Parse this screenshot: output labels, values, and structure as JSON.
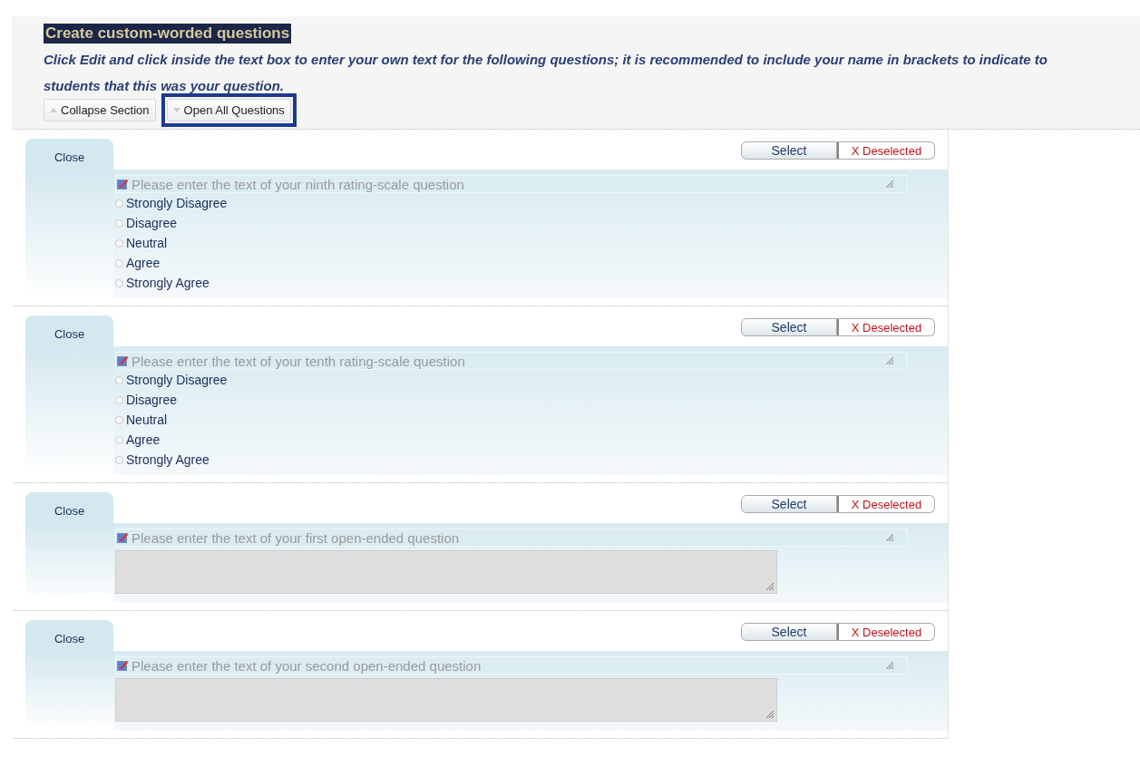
{
  "header": {
    "title": "Create custom-worded questions",
    "instructions": "Click Edit and click inside the text box to enter your own text for the following questions; it is recommended to include your name in brackets to indicate to students that this was your question.",
    "buttons": [
      {
        "label": "Collapse Section",
        "kind": "collapse",
        "highlighted": false
      },
      {
        "label": "Open All Questions",
        "kind": "expand",
        "highlighted": true
      }
    ]
  },
  "questions": [
    {
      "close_label": "Close",
      "select_label": "Select",
      "deselect_label": "X Deselected",
      "selected": false,
      "kind": "rating",
      "prompt": "Please enter the text of your ninth rating-scale question",
      "options": [
        {
          "label": "Strongly Disagree",
          "selected": false
        },
        {
          "label": "Disagree",
          "selected": false
        },
        {
          "label": "Neutral",
          "selected": false
        },
        {
          "label": "Agree",
          "selected": false
        },
        {
          "label": "Strongly Agree",
          "selected": false
        }
      ]
    },
    {
      "close_label": "Close",
      "select_label": "Select",
      "deselect_label": "X Deselected",
      "selected": false,
      "kind": "rating",
      "prompt": "Please enter the text of your tenth rating-scale question",
      "options": [
        {
          "label": "Strongly Disagree",
          "selected": false
        },
        {
          "label": "Disagree",
          "selected": false
        },
        {
          "label": "Neutral",
          "selected": false
        },
        {
          "label": "Agree",
          "selected": false
        },
        {
          "label": "Strongly Agree",
          "selected": false
        }
      ]
    },
    {
      "close_label": "Close",
      "select_label": "Select",
      "deselect_label": "X Deselected",
      "selected": false,
      "kind": "open",
      "prompt": "Please enter the text of your first open-ended question"
    },
    {
      "close_label": "Close",
      "select_label": "Select",
      "deselect_label": "X Deselected",
      "selected": false,
      "kind": "open",
      "prompt": "Please enter the text of your second open-ended question"
    }
  ]
}
